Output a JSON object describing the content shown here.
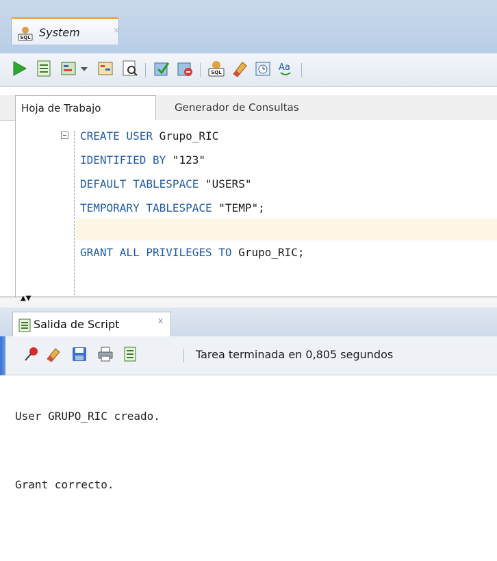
{
  "document_tab": {
    "title": "System",
    "close": "×"
  },
  "toolbar": {
    "buttons": [
      "run-statement-icon",
      "run-script-icon",
      "explain-plan-icon",
      "dropdown-arrow-icon",
      "autotrace-icon",
      "sql-tuning-icon",
      "commit-icon",
      "rollback-icon",
      "sql-worksheet-icon",
      "clear-icon",
      "history-icon",
      "change-case-icon"
    ]
  },
  "worksheet_tabs": [
    {
      "label": "Hoja de Trabajo",
      "active": true
    },
    {
      "label": "Generador de Consultas",
      "active": false
    }
  ],
  "editor": {
    "lines": [
      {
        "kw": "CREATE USER",
        "rest": " Grupo_RIC"
      },
      {
        "kw": "IDENTIFIED BY",
        "rest": " \"123\""
      },
      {
        "kw": "DEFAULT TABLESPACE",
        "rest": " \"USERS\""
      },
      {
        "kw": "TEMPORARY TABLESPACE",
        "rest": " \"TEMP\";"
      },
      {
        "kw": "GRANT ALL PRIVILEGES TO",
        "rest": " Grupo_RIC;"
      }
    ]
  },
  "output": {
    "tab_label": "Salida de Script",
    "tab_close": "x",
    "status": "Tarea terminada en 0,805 segundos",
    "lines": [
      "User GRUPO_RIC creado.",
      "Grant correcto."
    ]
  },
  "colors": {
    "keyword": "#1e5aa8",
    "tab_accent": "#f2a64a",
    "current_line": "#fdf6e6"
  }
}
